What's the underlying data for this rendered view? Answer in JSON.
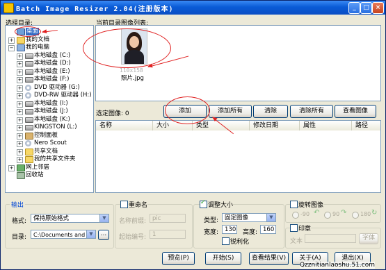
{
  "window": {
    "title": "Batch Image Resizer 2.04(注册版本)",
    "controls": {
      "minimize": "_",
      "maximize": "□",
      "close": "×"
    }
  },
  "left": {
    "heading": "选择目录:",
    "tree": [
      {
        "label": "桌面",
        "icon": "desktop-icon",
        "expand": ""
      },
      {
        "label": "我的文档",
        "icon": "folder-icon",
        "expand": "+"
      },
      {
        "label": "我的电脑",
        "icon": "computer-icon",
        "expand": "−"
      },
      {
        "label": "本地磁盘 (C:)",
        "icon": "drive-icon",
        "expand": "+"
      },
      {
        "label": "本地磁盘 (D:)",
        "icon": "drive-icon",
        "expand": "+"
      },
      {
        "label": "本地磁盘 (E:)",
        "icon": "drive-icon",
        "expand": "+"
      },
      {
        "label": "本地磁盘 (F:)",
        "icon": "drive-icon",
        "expand": "+"
      },
      {
        "label": "DVD 驱动器 (G:)",
        "icon": "cd-icon",
        "expand": "+"
      },
      {
        "label": "DVD-RW 驱动器 (H:)",
        "icon": "cd-icon",
        "expand": "+"
      },
      {
        "label": "本地磁盘 (I:)",
        "icon": "drive-icon",
        "expand": "+"
      },
      {
        "label": "本地磁盘 (J:)",
        "icon": "drive-icon",
        "expand": "+"
      },
      {
        "label": "本地磁盘 (K:)",
        "icon": "drive-icon",
        "expand": "+"
      },
      {
        "label": "KINGSTON (L:)",
        "icon": "drive-icon",
        "expand": "+"
      },
      {
        "label": "控制面板",
        "icon": "control-panel-icon",
        "expand": "+"
      },
      {
        "label": "Nero Scout",
        "icon": "cd-icon",
        "expand": "+"
      },
      {
        "label": "共享文档",
        "icon": "folder-icon",
        "expand": "+"
      },
      {
        "label": "我的共享文件夹",
        "icon": "folder-icon",
        "expand": "+"
      },
      {
        "label": "网上邻居",
        "icon": "network-icon",
        "expand": "+"
      },
      {
        "label": "回收站",
        "icon": "recycle-bin-icon",
        "expand": ""
      }
    ]
  },
  "images": {
    "heading": "当前目录图像列表:",
    "thumb": {
      "size": "110x158",
      "name": "照片.jpg"
    }
  },
  "selection": {
    "label": "选定图像: 0",
    "buttons": {
      "add": "添加",
      "add_all": "添加所有",
      "clear": "清除",
      "clear_all": "清除所有",
      "view": "查看图像"
    }
  },
  "table": {
    "columns": [
      "名称",
      "大小",
      "类型",
      "修改日期",
      "属性",
      "路径"
    ]
  },
  "output": {
    "title": "输出",
    "format_label": "格式:",
    "format_value": "保持原始格式",
    "dir_label": "目录:",
    "dir_value": "C:\\Documents and S",
    "browse": "..."
  },
  "rename": {
    "title": "重命名",
    "prefix_label": "名称前缀:",
    "prefix_value": "pic",
    "start_label": "起始编号:",
    "start_value": "1"
  },
  "resize": {
    "title": "调整大小",
    "type_label": "类型:",
    "type_value": "固定图像",
    "width_label": "宽度:",
    "width_value": "130",
    "height_label": "高度:",
    "height_value": "160",
    "sharpen": "锐利化"
  },
  "rotate": {
    "title": "旋转图像",
    "options": [
      "-90",
      "90",
      "180"
    ]
  },
  "stamp": {
    "title": "印章",
    "text_label": "文本",
    "font": "字体"
  },
  "footer": {
    "preview": "预览(P)",
    "start": "开始(S)",
    "results": "查看结果(V)",
    "about": "关于(A)",
    "exit": "退出(X)"
  },
  "watermark": "Qzznitianlaoshu.51.com"
}
